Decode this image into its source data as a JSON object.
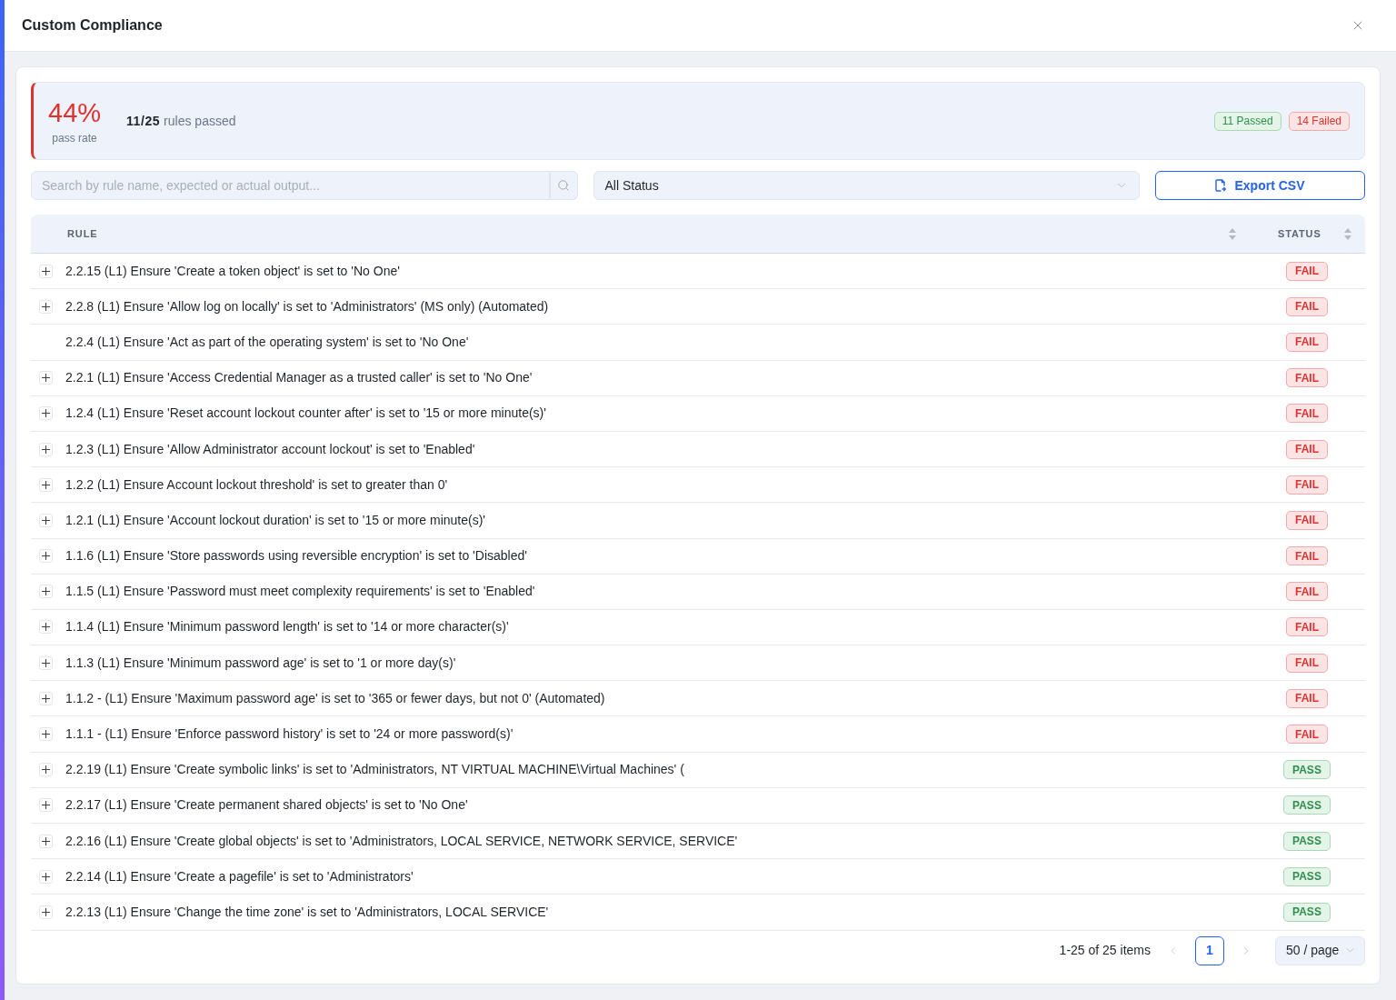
{
  "window": {
    "title": "Custom Compliance"
  },
  "summary": {
    "passing": false,
    "pass_rate": "44%",
    "pass_rate_label": "pass rate",
    "passed_count": "11/25",
    "passed_label": "rules passed",
    "badges": [
      {
        "kind": "passed",
        "label": "11 Passed"
      },
      {
        "kind": "failed",
        "label": "14 Failed"
      }
    ]
  },
  "toolbar": {
    "search": {
      "placeholder": "Search by rule name, expected or actual output..."
    },
    "status_filter": {
      "value": "All Status"
    },
    "export_button": {
      "label": "Export CSV"
    }
  },
  "table": {
    "columns": [
      {
        "label": "RULE",
        "sortable": true
      },
      {
        "label": "STATUS",
        "sortable": true
      }
    ],
    "rows": [
      {
        "rule": "2.2.15 (L1) Ensure 'Create a token object' is set to 'No One'",
        "status": "FAIL",
        "kind": "fail",
        "expandable": true
      },
      {
        "rule": "2.2.8 (L1) Ensure 'Allow log on locally' is set to 'Administrators' (MS only) (Automated)",
        "status": "FAIL",
        "kind": "fail",
        "expandable": true
      },
      {
        "rule": "2.2.4 (L1) Ensure 'Act as part of the operating system' is set to 'No One'",
        "status": "FAIL",
        "kind": "fail",
        "expandable": false
      },
      {
        "rule": "2.2.1 (L1) Ensure 'Access Credential Manager as a trusted caller' is set to 'No One'",
        "status": "FAIL",
        "kind": "fail",
        "expandable": true
      },
      {
        "rule": "1.2.4 (L1) Ensure 'Reset account lockout counter after' is set to '15 or more minute(s)'",
        "status": "FAIL",
        "kind": "fail",
        "expandable": true
      },
      {
        "rule": "1.2.3 (L1) Ensure 'Allow Administrator account lockout' is set to 'Enabled'",
        "status": "FAIL",
        "kind": "fail",
        "expandable": true
      },
      {
        "rule": "1.2.2 (L1) Ensure Account lockout threshold' is set to greater than 0'",
        "status": "FAIL",
        "kind": "fail",
        "expandable": true
      },
      {
        "rule": "1.2.1 (L1) Ensure 'Account lockout duration' is set to '15 or more minute(s)'",
        "status": "FAIL",
        "kind": "fail",
        "expandable": true
      },
      {
        "rule": "1.1.6 (L1) Ensure 'Store passwords using reversible encryption' is set to 'Disabled'",
        "status": "FAIL",
        "kind": "fail",
        "expandable": true
      },
      {
        "rule": "1.1.5 (L1) Ensure 'Password must meet complexity requirements' is set to 'Enabled'",
        "status": "FAIL",
        "kind": "fail",
        "expandable": true
      },
      {
        "rule": "1.1.4 (L1) Ensure 'Minimum password length' is set to '14 or more character(s)'",
        "status": "FAIL",
        "kind": "fail",
        "expandable": true
      },
      {
        "rule": "1.1.3 (L1) Ensure 'Minimum password age' is set to '1 or more day(s)'",
        "status": "FAIL",
        "kind": "fail",
        "expandable": true
      },
      {
        "rule": "1.1.2 - (L1) Ensure 'Maximum password age' is set to '365 or fewer days, but not 0' (Automated)",
        "status": "FAIL",
        "kind": "fail",
        "expandable": true
      },
      {
        "rule": "1.1.1 - (L1) Ensure 'Enforce password history' is set to '24 or more password(s)'",
        "status": "FAIL",
        "kind": "fail",
        "expandable": true
      },
      {
        "rule": "2.2.19 (L1) Ensure 'Create symbolic links' is set to 'Administrators, NT VIRTUAL MACHINE\\Virtual Machines' (",
        "status": "PASS",
        "kind": "pass",
        "expandable": true
      },
      {
        "rule": "2.2.17 (L1) Ensure 'Create permanent shared objects' is set to 'No One'",
        "status": "PASS",
        "kind": "pass",
        "expandable": true
      },
      {
        "rule": "2.2.16 (L1) Ensure 'Create global objects' is set to 'Administrators, LOCAL SERVICE, NETWORK SERVICE, SERVICE'",
        "status": "PASS",
        "kind": "pass",
        "expandable": true
      },
      {
        "rule": "2.2.14 (L1) Ensure 'Create a pagefile' is set to 'Administrators'",
        "status": "PASS",
        "kind": "pass",
        "expandable": true
      },
      {
        "rule": "2.2.13 (L1) Ensure 'Change the time zone' is set to 'Administrators, LOCAL SERVICE'",
        "status": "PASS",
        "kind": "pass",
        "expandable": true
      }
    ]
  },
  "pagination": {
    "range": "1-25 of 25 items",
    "prev": {
      "disabled": true
    },
    "pages": [
      {
        "label": "1",
        "selected": true
      }
    ],
    "next": {
      "disabled": true
    },
    "page_size": "50 / page"
  }
}
